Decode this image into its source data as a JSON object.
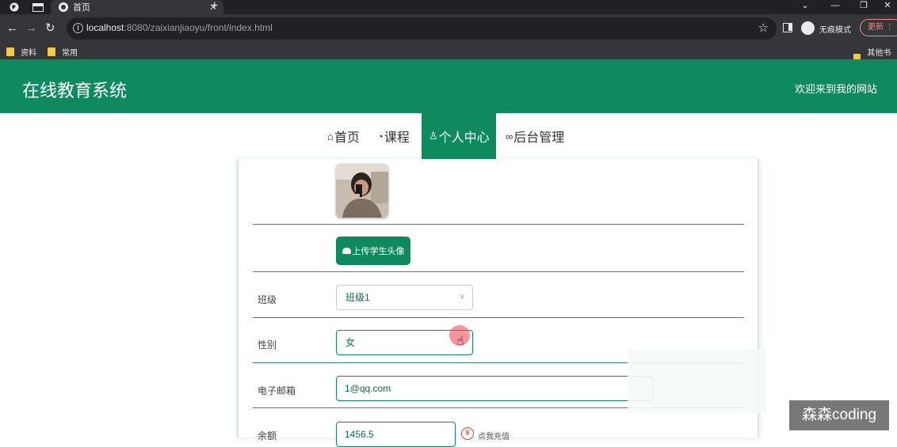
{
  "browser": {
    "active_tab_title": "首页",
    "url_host": "localhost",
    "url_rest": ":8080/zaixianjiaoyu/front/index.html",
    "incognito_label": "无痕模式",
    "update_label": "更新",
    "bookmarks": [
      "资料",
      "常用"
    ],
    "other_bookmarks": "其他书签"
  },
  "header": {
    "title": "在线教育系统",
    "welcome": "欢迎来到我的网站"
  },
  "nav": {
    "items": [
      {
        "label": "首页",
        "icon": "home-icon"
      },
      {
        "label": "课程",
        "icon": "dashboard-icon"
      },
      {
        "label": "个人中心",
        "icon": "user-icon"
      },
      {
        "label": "后台管理",
        "icon": "link-icon"
      }
    ],
    "active": "个人中心"
  },
  "form": {
    "upload_button": "上传学生头像",
    "class_label": "班级",
    "class_value": "班级1",
    "gender_label": "性别",
    "gender_value": "女",
    "email_label": "电子邮箱",
    "email_value": "1@qq.com",
    "balance_label": "余额",
    "balance_value": "1456.5",
    "recharge_text": "点我充值"
  },
  "watermark": "森森coding",
  "colors": {
    "primary": "#0f8a5f",
    "chrome_dark": "#202124",
    "chrome_toolbar": "#35363a",
    "danger": "#e53935"
  }
}
